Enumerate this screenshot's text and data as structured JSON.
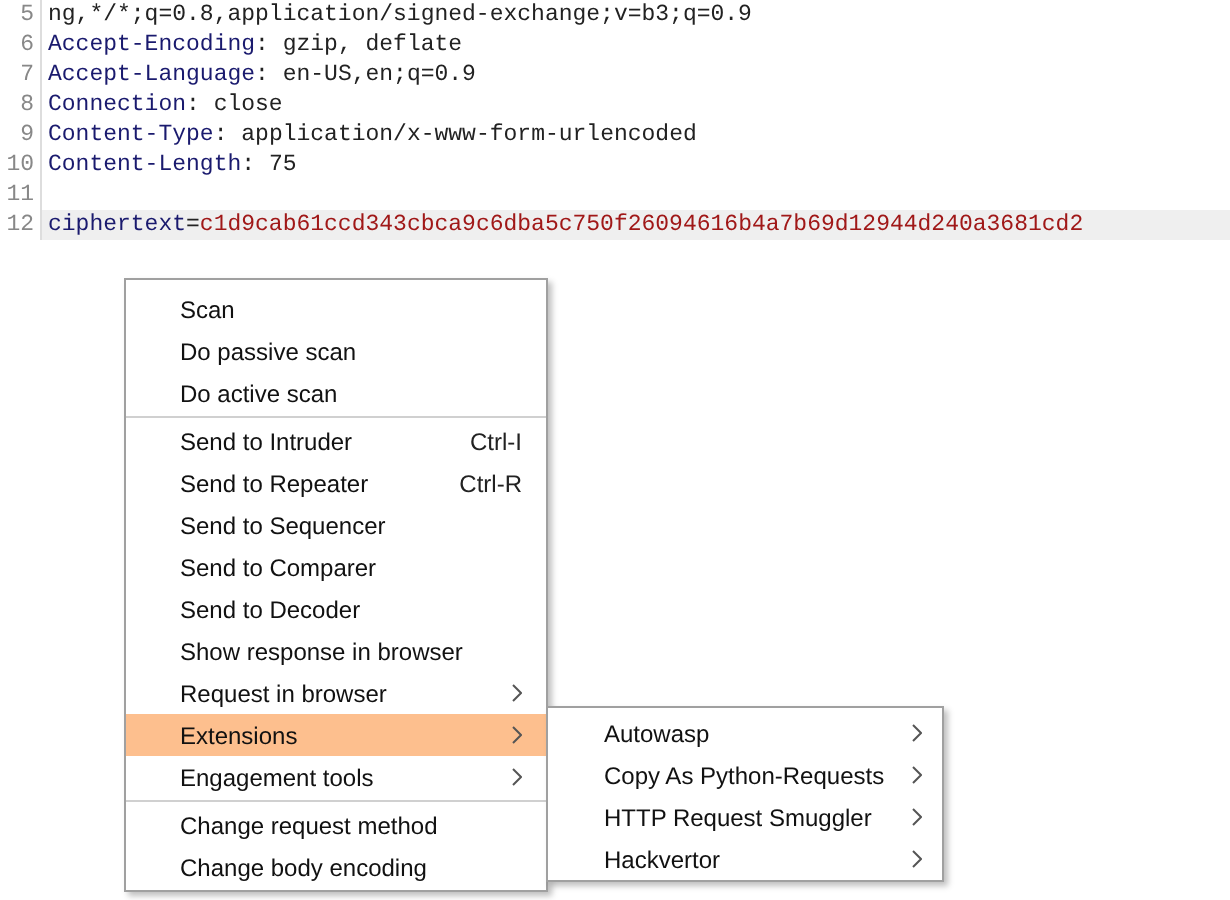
{
  "editor": {
    "lines": [
      {
        "number": "5",
        "kind": "plain",
        "value": "ng,*/*;q=0.8,application/signed-exchange;v=b3;q=0.9"
      },
      {
        "number": "6",
        "kind": "header",
        "key": "Accept-Encoding",
        "separator": ": ",
        "value": "gzip, deflate"
      },
      {
        "number": "7",
        "kind": "header",
        "key": "Accept-Language",
        "separator": ": ",
        "value": "en-US,en;q=0.9"
      },
      {
        "number": "8",
        "kind": "header",
        "key": "Connection",
        "separator": ": ",
        "value": "close"
      },
      {
        "number": "9",
        "kind": "header",
        "key": "Content-Type",
        "separator": ": ",
        "value": "application/x-www-form-urlencoded"
      },
      {
        "number": "10",
        "kind": "header",
        "key": "Content-Length",
        "separator": ": ",
        "value": "75"
      },
      {
        "number": "11",
        "kind": "blank"
      },
      {
        "number": "12",
        "kind": "param",
        "key": "ciphertext",
        "separator": "=",
        "value": "c1d9cab61ccd343cbca9c6dba5c750f26094616b4a7b69d12944d240a3681cd2",
        "selected": true
      }
    ]
  },
  "context_menu": {
    "groups": [
      [
        {
          "label": "Scan",
          "selected": false,
          "submenu": false
        },
        {
          "label": "Do passive scan",
          "selected": false,
          "submenu": false
        },
        {
          "label": "Do active scan",
          "selected": false,
          "submenu": false
        }
      ],
      [
        {
          "label": "Send to Intruder",
          "shortcut": "Ctrl-I",
          "selected": false,
          "submenu": false
        },
        {
          "label": "Send to Repeater",
          "shortcut": "Ctrl-R",
          "selected": false,
          "submenu": false
        },
        {
          "label": "Send to Sequencer",
          "selected": false,
          "submenu": false
        },
        {
          "label": "Send to Comparer",
          "selected": false,
          "submenu": false
        },
        {
          "label": "Send to Decoder",
          "selected": false,
          "submenu": false
        },
        {
          "label": "Show response in browser",
          "selected": false,
          "submenu": false
        },
        {
          "label": "Request in browser",
          "selected": false,
          "submenu": true
        },
        {
          "label": "Extensions",
          "selected": true,
          "submenu": true
        },
        {
          "label": "Engagement tools",
          "selected": false,
          "submenu": true
        }
      ],
      [
        {
          "label": "Change request method",
          "selected": false,
          "submenu": false
        },
        {
          "label": "Change body encoding",
          "selected": false,
          "submenu": false
        }
      ]
    ]
  },
  "submenu": {
    "items": [
      {
        "label": "Autowasp",
        "submenu": true
      },
      {
        "label": "Copy As Python-Requests",
        "submenu": true
      },
      {
        "label": "HTTP Request Smuggler",
        "submenu": true
      },
      {
        "label": "Hackvertor",
        "submenu": true
      }
    ]
  }
}
